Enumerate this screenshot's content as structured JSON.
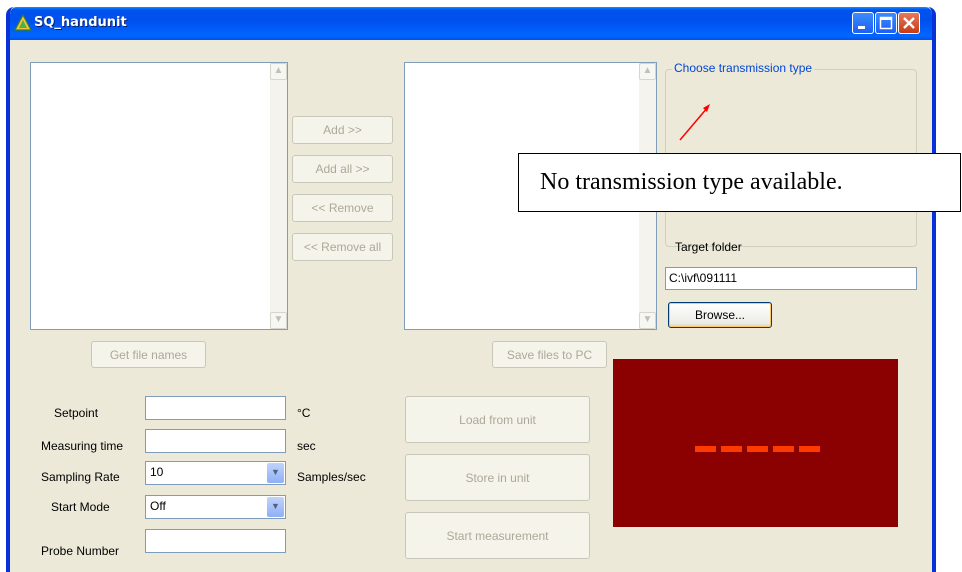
{
  "window": {
    "title": "SQ_handunit"
  },
  "file_transfer": {
    "add_label": "Add >>",
    "add_all_label": "Add all >>",
    "remove_label": "<< Remove",
    "remove_all_label": "<< Remove all",
    "get_file_names_label": "Get file names",
    "save_files_label": "Save files to PC"
  },
  "transmission": {
    "group_title": "Choose transmission type",
    "target_folder_label": "Target folder",
    "target_folder_value": "C:\\ivf\\091111",
    "browse_label": "Browse..."
  },
  "settings": {
    "setpoint_label": "Setpoint",
    "setpoint_value": "",
    "setpoint_unit": "°C",
    "measuring_time_label": "Measuring time",
    "measuring_time_value": "",
    "measuring_time_unit": "sec",
    "sampling_rate_label": "Sampling Rate",
    "sampling_rate_value": "10",
    "sampling_rate_unit": "Samples/sec",
    "start_mode_label": "Start Mode",
    "start_mode_value": "Off",
    "probe_number_label": "Probe Number",
    "probe_number_value": ""
  },
  "actions": {
    "load_label": "Load from unit",
    "store_label": "Store in unit",
    "start_label": "Start measurement"
  },
  "display": {
    "readout": "-----",
    "segment_color": "#ff3a00",
    "background": "#8b0000"
  },
  "annotation": {
    "callout_text": "No transmission type available."
  },
  "colors": {
    "title_bar": "#0054e3",
    "dialog_bg": "#ece9d8",
    "group_title": "#0046d5"
  }
}
